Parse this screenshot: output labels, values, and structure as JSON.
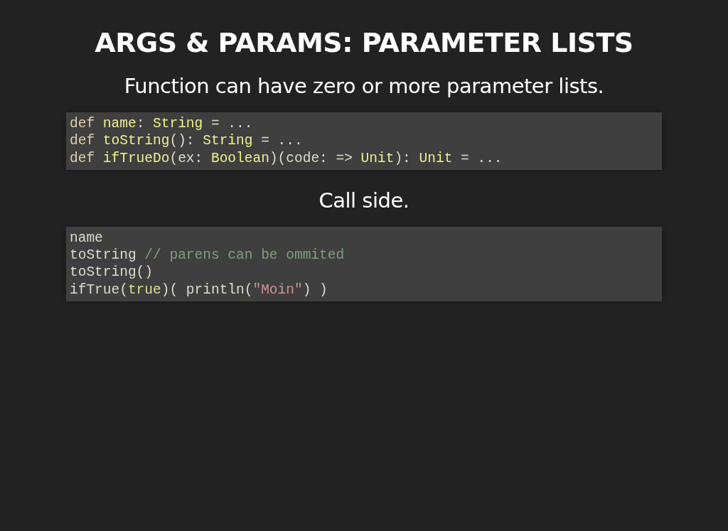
{
  "title": "ARGS & PARAMS: PARAMETER LISTS",
  "sections": [
    {
      "text": "Function can have zero or more parameter lists.",
      "code": [
        [
          {
            "kind": "keyword",
            "text": "def "
          },
          {
            "kind": "name",
            "text": "name"
          },
          {
            "kind": "plain",
            "text": ": "
          },
          {
            "kind": "type",
            "text": "String"
          },
          {
            "kind": "plain",
            "text": " = ..."
          }
        ],
        [
          {
            "kind": "keyword",
            "text": "def "
          },
          {
            "kind": "name",
            "text": "toString"
          },
          {
            "kind": "plain",
            "text": "(): "
          },
          {
            "kind": "type",
            "text": "String"
          },
          {
            "kind": "plain",
            "text": " = ..."
          }
        ],
        [
          {
            "kind": "keyword",
            "text": "def "
          },
          {
            "kind": "name",
            "text": "ifTrueDo"
          },
          {
            "kind": "plain",
            "text": "(ex: "
          },
          {
            "kind": "type",
            "text": "Boolean"
          },
          {
            "kind": "plain",
            "text": ")(code: => "
          },
          {
            "kind": "type",
            "text": "Unit"
          },
          {
            "kind": "plain",
            "text": "): "
          },
          {
            "kind": "type",
            "text": "Unit"
          },
          {
            "kind": "plain",
            "text": " = ..."
          }
        ]
      ]
    },
    {
      "text": "Call side.",
      "code": [
        [
          {
            "kind": "plain",
            "text": "name"
          }
        ],
        [
          {
            "kind": "plain",
            "text": "toString "
          },
          {
            "kind": "comment",
            "text": "// parens can be ommited"
          }
        ],
        [
          {
            "kind": "plain",
            "text": "toString()"
          }
        ],
        [
          {
            "kind": "plain",
            "text": "ifTrue("
          },
          {
            "kind": "literal",
            "text": "true"
          },
          {
            "kind": "plain",
            "text": ")( println("
          },
          {
            "kind": "string",
            "text": "\"Moin\""
          },
          {
            "kind": "plain",
            "text": ") )"
          }
        ]
      ]
    }
  ]
}
